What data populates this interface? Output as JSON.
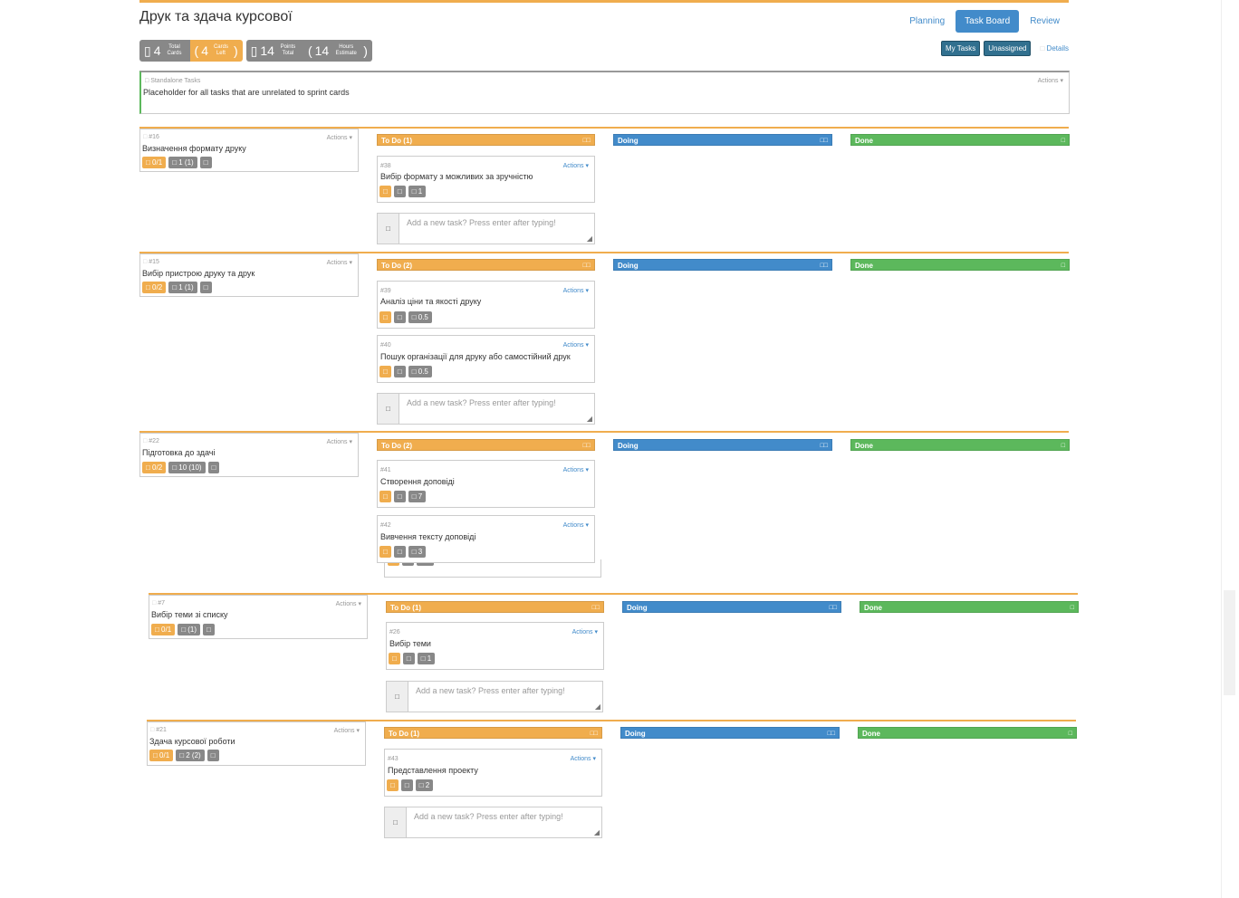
{
  "title": "Друк та здача курсової",
  "tabs": [
    "Planning",
    "Task Board",
    "Review"
  ],
  "active_tab": "Task Board",
  "stats": {
    "cards_total": "4",
    "cards_total_label": "Total Cards",
    "cards_left": "4",
    "cards_left_label": "Cards Left",
    "points_total": "14",
    "points_total_label": "Points Total",
    "hours_estimate": "14",
    "hours_estimate_label": "Hours Estimate"
  },
  "filters": {
    "my_tasks": "My Tasks",
    "unassigned": "Unassigned",
    "details": "Details"
  },
  "standalone": {
    "header": "Standalone Tasks",
    "description": "Placeholder for all tasks that are unrelated to sprint cards",
    "actions": "Actions"
  },
  "actions_label": "Actions",
  "add_task_placeholder": "Add a new task? Press enter after typing!",
  "column_labels": {
    "doing": "Doing",
    "done": "Done"
  },
  "rows": [
    {
      "card": {
        "num": "#16",
        "name": "Визначення формату друку",
        "b1": "□ 0/1",
        "b2": "□ 1 (1)",
        "b3": "□"
      },
      "todo_label": "To Do (1)",
      "tasks": [
        {
          "num": "#38",
          "name": "Вибір формату з можливих за зручністю",
          "b3": "□ 1"
        }
      ]
    },
    {
      "card": {
        "num": "#15",
        "name": "Вибір пристрою друку та друк",
        "b1": "□ 0/2",
        "b2": "□ 1 (1)",
        "b3": "□"
      },
      "todo_label": "To Do (2)",
      "tasks": [
        {
          "num": "#39",
          "name": "Аналіз ціни та якості друку",
          "b3": "□ 0.5"
        },
        {
          "num": "#40",
          "name": "Пошук організації для друку або самостійний друк",
          "b3": "□ 0.5"
        }
      ]
    },
    {
      "card": {
        "num": "#22",
        "name": "Підготовка до здачі",
        "b1": "□ 0/2",
        "b2": "□ 10 (10)",
        "b3": "□"
      },
      "todo_label": "To Do (2)",
      "tasks": [
        {
          "num": "#41",
          "name": "Створення доповіді",
          "b3": "□ 7"
        },
        {
          "num": "#42",
          "name": "Вивчення тексту доповіді",
          "b3": "□ 3"
        }
      ]
    },
    {
      "card": {
        "num": "#7",
        "name": "Вибір теми зі списку",
        "b1": "□ 0/1",
        "b2": "□ (1)",
        "b3": "□"
      },
      "todo_label": "To Do (1)",
      "tasks": [
        {
          "num": "#26",
          "name": "Вибір теми",
          "b3": "□ 1"
        }
      ]
    },
    {
      "card": {
        "num": "#21",
        "name": "Здача курсової роботи",
        "b1": "□ 0/1",
        "b2": "□ 2 (2)",
        "b3": "□"
      },
      "todo_label": "To Do (1)",
      "tasks": [
        {
          "num": "#43",
          "name": "Представлення проекту",
          "b3": "□ 2"
        }
      ]
    }
  ],
  "colors": {
    "todo": "#f0ad4e",
    "doing": "#428bca",
    "done": "#5cb85c",
    "badge_gray": "#888888"
  }
}
